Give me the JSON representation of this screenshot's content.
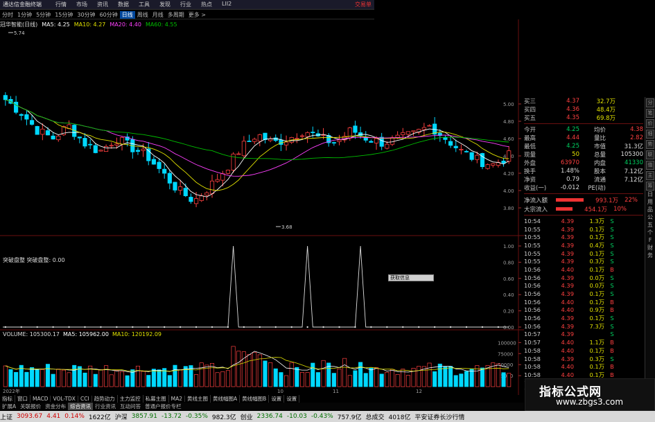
{
  "window": {
    "title": "通达信金融终端",
    "brand": "交易单"
  },
  "menu": [
    "行情",
    "市场",
    "资讯",
    "数据",
    "工具",
    "发现",
    "行业",
    "热点",
    "LII2"
  ],
  "periods": [
    {
      "label": "分时",
      "selected": false
    },
    {
      "label": "1分钟",
      "selected": false
    },
    {
      "label": "5分钟",
      "selected": false
    },
    {
      "label": "15分钟",
      "selected": false
    },
    {
      "label": "30分钟",
      "selected": false
    },
    {
      "label": "60分钟",
      "selected": false
    },
    {
      "label": "日线",
      "selected": true
    },
    {
      "label": "周线",
      "selected": false
    },
    {
      "label": "月线",
      "selected": false
    },
    {
      "label": "多周期",
      "selected": false
    },
    {
      "label": "更多 >",
      "selected": false
    }
  ],
  "ma_legend": {
    "stock": "冠华智能(日线)",
    "ma5": "MA5: 4.25",
    "ma10": "MA10: 4.27",
    "ma20": "MA20: 4.40",
    "ma60": "MA60: 4.55"
  },
  "colors": {
    "up": "#ff4040",
    "down": "#00d8ff",
    "ma5": "#ffffff",
    "ma10": "#e0e000",
    "ma20": "#ff40ff",
    "ma60": "#00c000"
  },
  "price_axis": [
    "5.00",
    "4.80",
    "4.60",
    "4.40",
    "4.20",
    "4.00",
    "3.80"
  ],
  "high_label": "5.74",
  "low_label": "3.68",
  "indicator2": {
    "legend": "突破盘整  突破盘整: 0.00",
    "axis": [
      "1.00",
      "0.80",
      "0.60",
      "0.40",
      "0.20",
      "0.00"
    ],
    "tooltip": "获取信息"
  },
  "volume": {
    "legend": [
      {
        "text": "VOLUME: 105300.17",
        "color": "#ddd"
      },
      {
        "text": "MA5: 105962.00",
        "color": "#ffffff"
      },
      {
        "text": "MA10: 120192.09",
        "color": "#e0e000"
      }
    ],
    "axis": [
      "100000",
      "75000",
      "50000",
      "25000"
    ],
    "date_labels": [
      "2022年",
      "10",
      "11",
      "12"
    ]
  },
  "quote": {
    "top_rows": [
      {
        "a": "买三",
        "b": "4.37",
        "c": "32.7万",
        "bc": "red"
      },
      {
        "a": "买四",
        "b": "4.36",
        "c": "48.4万",
        "bc": "red"
      },
      {
        "a": "买五",
        "b": "4.35",
        "c": "69.8万",
        "bc": "red"
      }
    ],
    "grid": [
      {
        "a": "今开",
        "b": "4.25",
        "bc": "green",
        "c": "均价",
        "d": "4.38",
        "dc": "red"
      },
      {
        "a": "最高",
        "b": "4.44",
        "bc": "red",
        "c": "量比",
        "d": "2.82",
        "dc": "red"
      },
      {
        "a": "最低",
        "b": "4.25",
        "bc": "green",
        "c": "市值",
        "d": "31.3亿",
        "dc": "white"
      },
      {
        "a": "现量",
        "b": "50",
        "bc": "yellow",
        "c": "总量",
        "d": "105300",
        "dc": "white"
      },
      {
        "a": "外盘",
        "b": "63970",
        "bc": "red",
        "c": "内盘",
        "d": "41330",
        "dc": "green"
      },
      {
        "a": "换手",
        "b": "1.48%",
        "bc": "white",
        "c": "股本",
        "d": "7.12亿",
        "dc": "white"
      },
      {
        "a": "净资",
        "b": "0.79",
        "bc": "white",
        "c": "流通",
        "d": "7.12亿",
        "dc": "white"
      },
      {
        "a": "收益(一)",
        "b": "-0.012",
        "bc": "white",
        "c": "PE(动)",
        "d": "",
        "dc": "white"
      }
    ],
    "flows": [
      {
        "name": "净流入额",
        "value": "993.1万",
        "pct": "22%",
        "bar": 40
      },
      {
        "name": "大宗流入",
        "value": "454.1万",
        "pct": "10%",
        "bar": 24
      }
    ],
    "ticks": [
      {
        "t": "10:54",
        "p": "4.39",
        "v": "1.3万",
        "d": "S"
      },
      {
        "t": "10:55",
        "p": "4.39",
        "v": "0.1万",
        "d": "S"
      },
      {
        "t": "10:55",
        "p": "4.39",
        "v": "0.1万",
        "d": "S"
      },
      {
        "t": "10:55",
        "p": "4.39",
        "v": "0.4万",
        "d": "S"
      },
      {
        "t": "10:55",
        "p": "4.39",
        "v": "0.1万",
        "d": "S"
      },
      {
        "t": "10:55",
        "p": "4.39",
        "v": "0.3万",
        "d": "S"
      },
      {
        "t": "10:56",
        "p": "4.40",
        "v": "0.1万",
        "d": "B"
      },
      {
        "t": "10:56",
        "p": "4.39",
        "v": "0.0万",
        "d": "S"
      },
      {
        "t": "10:56",
        "p": "4.39",
        "v": "0.0万",
        "d": "S"
      },
      {
        "t": "10:56",
        "p": "4.39",
        "v": "0.1万",
        "d": "S"
      },
      {
        "t": "10:56",
        "p": "4.40",
        "v": "0.1万",
        "d": "B"
      },
      {
        "t": "10:56",
        "p": "4.40",
        "v": "0.9万",
        "d": "B"
      },
      {
        "t": "10:56",
        "p": "4.39",
        "v": "0.1万",
        "d": "S"
      },
      {
        "t": "10:56",
        "p": "4.39",
        "v": "7.3万",
        "d": "S"
      },
      {
        "t": "10:57",
        "p": "4.39",
        "v": "",
        "d": "S"
      },
      {
        "t": "10:57",
        "p": "4.40",
        "v": "1.1万",
        "d": "B"
      },
      {
        "t": "10:58",
        "p": "4.40",
        "v": "0.1万",
        "d": "B"
      },
      {
        "t": "10:58",
        "p": "4.39",
        "v": "0.3万",
        "d": "S"
      },
      {
        "t": "10:58",
        "p": "4.40",
        "v": "0.1万",
        "d": "B"
      },
      {
        "t": "10:58",
        "p": "4.40",
        "v": "0.1万",
        "d": "B"
      },
      {
        "t": "10:58",
        "p": "4.40",
        "v": "0.1万",
        "d": "B"
      },
      {
        "t": "10:58",
        "p": "4.39",
        "v": "",
        "d": "S"
      }
    ]
  },
  "side_tabs": [
    "分",
    "笔",
    "价",
    "细",
    "势",
    "联",
    "值",
    "主",
    "筹"
  ],
  "side_text": [
    "日",
    "用",
    "品",
    "公",
    "五",
    "个",
    "F",
    "财",
    "务"
  ],
  "bottom_tabs": [
    {
      "label": "指标",
      "selected": false
    },
    {
      "label": "窗口",
      "selected": false
    },
    {
      "label": "MACD",
      "selected": false
    },
    {
      "label": "VOL-TDX",
      "selected": false
    },
    {
      "label": "CCI",
      "selected": false
    },
    {
      "label": "趋势动力",
      "selected": false
    },
    {
      "label": "主力监控",
      "selected": false
    },
    {
      "label": "私募主图",
      "selected": false
    },
    {
      "label": "MA2",
      "selected": false
    },
    {
      "label": "黄线主图",
      "selected": false
    },
    {
      "label": "黄线幅图A",
      "selected": false
    },
    {
      "label": "黄线幅图B",
      "selected": false
    },
    {
      "label": "设置",
      "selected": false
    },
    {
      "label": "设置",
      "selected": false
    }
  ],
  "func_tabs": [
    {
      "label": "扩展A",
      "selected": false
    },
    {
      "label": "关联报价",
      "selected": false
    },
    {
      "label": "资金分布",
      "selected": false
    },
    {
      "label": "综合资讯",
      "selected": true
    },
    {
      "label": "行业资讯",
      "selected": false
    },
    {
      "label": "互动问答",
      "selected": false
    },
    {
      "label": "普通户报价专栏",
      "selected": false
    }
  ],
  "status": [
    {
      "text": "上证",
      "cls": "sn"
    },
    {
      "text": "3093.67",
      "cls": "sr"
    },
    {
      "text": "4.41",
      "cls": "sr"
    },
    {
      "text": "0.14%",
      "cls": "sr"
    },
    {
      "text": "1622亿",
      "cls": "sb"
    },
    {
      "text": "沪深",
      "cls": "sn"
    },
    {
      "text": "3857.91",
      "cls": "sg"
    },
    {
      "text": "-13.72",
      "cls": "sg"
    },
    {
      "text": "-0.35%",
      "cls": "sg"
    },
    {
      "text": "982.3亿",
      "cls": "sb"
    },
    {
      "text": "创业",
      "cls": "sn"
    },
    {
      "text": "2336.74",
      "cls": "sg"
    },
    {
      "text": "-10.03",
      "cls": "sg"
    },
    {
      "text": "-0.43%",
      "cls": "sg"
    },
    {
      "text": "757.9亿",
      "cls": "sb"
    },
    {
      "text": "总成交",
      "cls": "sn"
    },
    {
      "text": "4018亿",
      "cls": "sb"
    },
    {
      "text": "平安证券长沙行情",
      "cls": "sn"
    }
  ],
  "watermark": {
    "cn": "指标公式网",
    "url": "www.zbgs3.com"
  }
}
